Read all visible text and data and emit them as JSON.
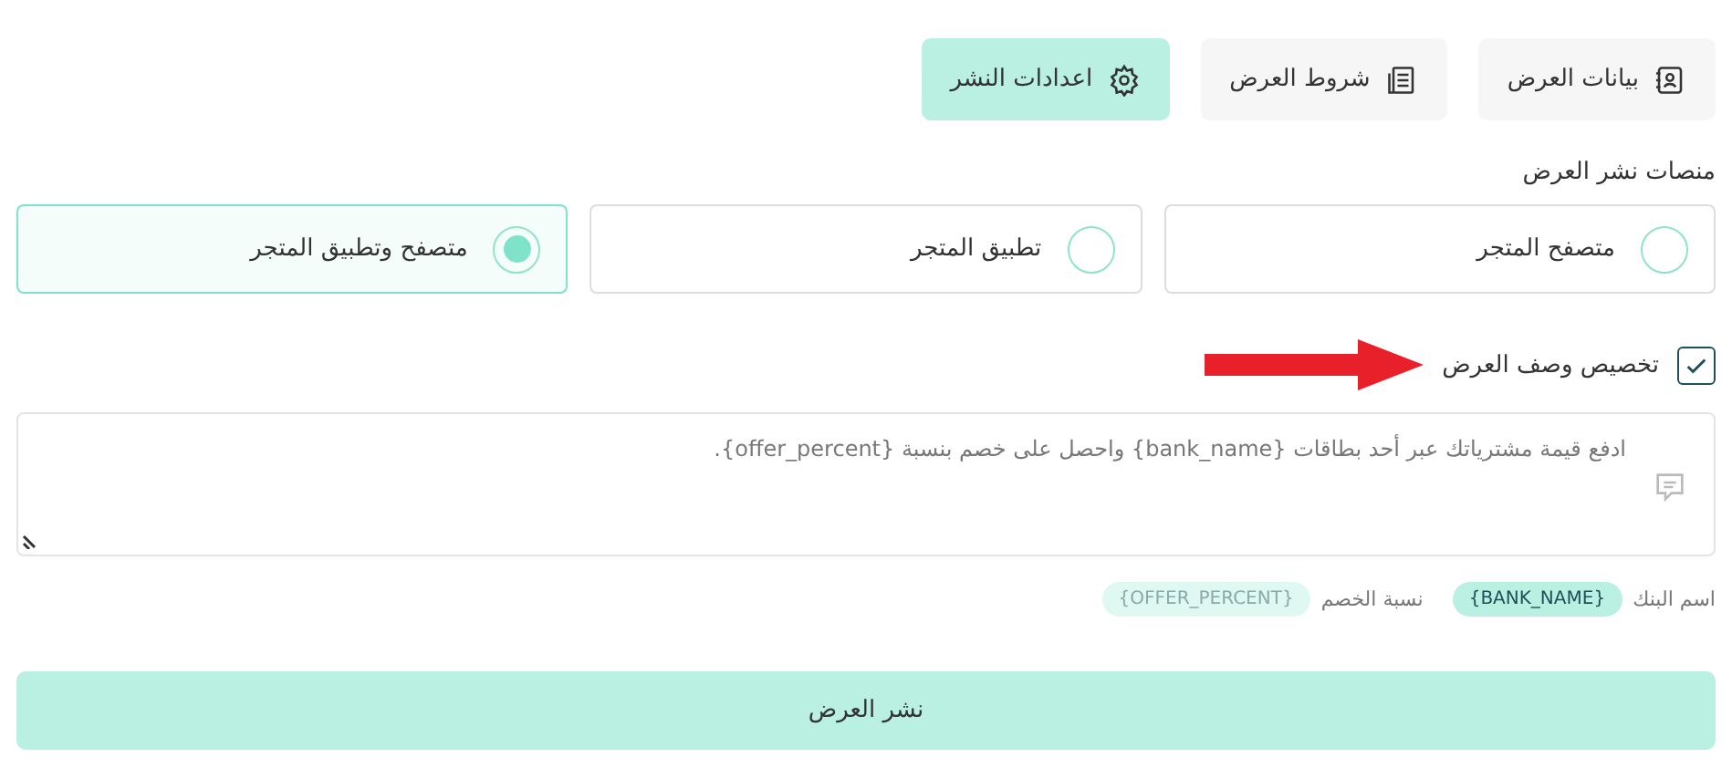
{
  "tabs": [
    {
      "kind": "data",
      "label": "بيانات العرض",
      "selected": false
    },
    {
      "kind": "terms",
      "label": "شروط العرض",
      "selected": false
    },
    {
      "kind": "settings",
      "label": "اعدادات النشر",
      "selected": true
    }
  ],
  "platforms": {
    "label": "منصات نشر العرض",
    "options": [
      {
        "label": "متصفح المتجر",
        "selected": false
      },
      {
        "label": "تطبيق المتجر",
        "selected": false
      },
      {
        "label": "متصفح وتطبيق المتجر",
        "selected": true
      }
    ]
  },
  "customize": {
    "label": "تخصيص وصف العرض",
    "checked": true
  },
  "description": {
    "value": "ادفع قيمة مشترياتك عبر أحد بطاقات {bank_name} واحصل على خصم بنسبة {offer_percent}."
  },
  "variables": [
    {
      "label": "اسم البنك",
      "tag": "{BANK_NAME}",
      "active": true
    },
    {
      "label": "نسبة الخصم",
      "tag": "{OFFER_PERCENT}",
      "active": false
    }
  ],
  "submit": "نشر العرض"
}
